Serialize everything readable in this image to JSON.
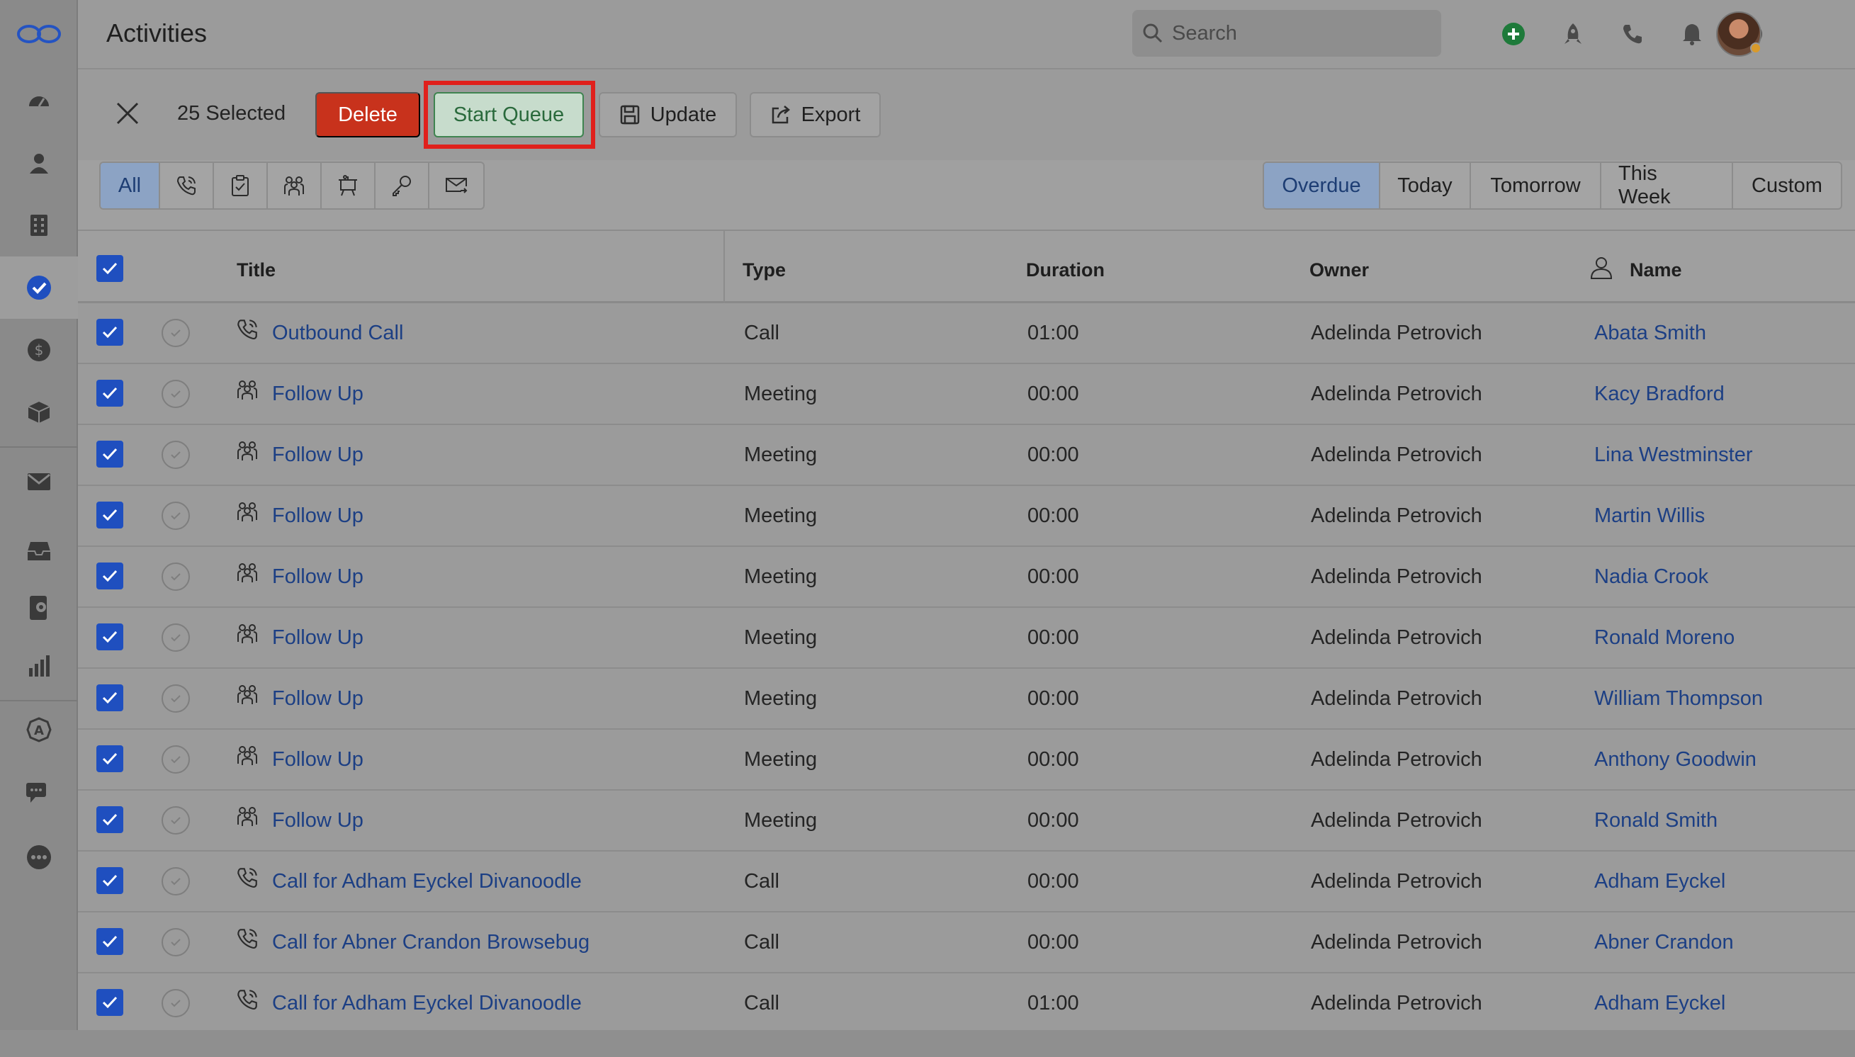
{
  "app": {
    "title": "Activities",
    "search_placeholder": "Search"
  },
  "sidebar": {
    "items": [
      {
        "icon": "dashboard-icon"
      },
      {
        "icon": "person-icon"
      },
      {
        "icon": "building-icon"
      },
      {
        "icon": "activities-check-icon",
        "active": true
      },
      {
        "icon": "dollar-icon"
      },
      {
        "icon": "box-icon"
      },
      {
        "icon": "mail-icon"
      },
      {
        "icon": "inbox-icon"
      },
      {
        "icon": "phone-book-icon"
      },
      {
        "icon": "reports-icon"
      },
      {
        "icon": "automation-icon"
      },
      {
        "icon": "chat-icon"
      },
      {
        "icon": "more-icon"
      }
    ]
  },
  "header_icons": [
    "add-icon",
    "rocket-icon",
    "phone-icon",
    "bell-icon",
    "help-icon"
  ],
  "actions": {
    "selected_label": "25 Selected",
    "delete_label": "Delete",
    "start_queue_label": "Start Queue",
    "update_label": "Update",
    "export_label": "Export"
  },
  "type_filter": {
    "all_label": "All",
    "icons": [
      "phone-icon",
      "task-clipboard-icon",
      "meeting-people-icon",
      "presentation-icon",
      "key-icon",
      "email-icon"
    ]
  },
  "date_filter": [
    "Overdue",
    "Today",
    "Tomorrow",
    "This Week",
    "Custom"
  ],
  "table": {
    "columns": {
      "title": "Title",
      "type": "Type",
      "duration": "Duration",
      "owner": "Owner",
      "name": "Name"
    },
    "rows": [
      {
        "title": "Outbound Call",
        "type": "Call",
        "duration": "01:00",
        "owner": "Adelinda Petrovich",
        "name": "Abata Smith",
        "icon": "phone-icon"
      },
      {
        "title": "Follow Up",
        "type": "Meeting",
        "duration": "00:00",
        "owner": "Adelinda Petrovich",
        "name": "Kacy Bradford",
        "icon": "meeting-people-icon"
      },
      {
        "title": "Follow Up",
        "type": "Meeting",
        "duration": "00:00",
        "owner": "Adelinda Petrovich",
        "name": "Lina Westminster",
        "icon": "meeting-people-icon"
      },
      {
        "title": "Follow Up",
        "type": "Meeting",
        "duration": "00:00",
        "owner": "Adelinda Petrovich",
        "name": "Martin Willis",
        "icon": "meeting-people-icon"
      },
      {
        "title": "Follow Up",
        "type": "Meeting",
        "duration": "00:00",
        "owner": "Adelinda Petrovich",
        "name": "Nadia Crook",
        "icon": "meeting-people-icon"
      },
      {
        "title": "Follow Up",
        "type": "Meeting",
        "duration": "00:00",
        "owner": "Adelinda Petrovich",
        "name": "Ronald Moreno",
        "icon": "meeting-people-icon"
      },
      {
        "title": "Follow Up",
        "type": "Meeting",
        "duration": "00:00",
        "owner": "Adelinda Petrovich",
        "name": "William Thompson",
        "icon": "meeting-people-icon"
      },
      {
        "title": "Follow Up",
        "type": "Meeting",
        "duration": "00:00",
        "owner": "Adelinda Petrovich",
        "name": "Anthony Goodwin",
        "icon": "meeting-people-icon"
      },
      {
        "title": "Follow Up",
        "type": "Meeting",
        "duration": "00:00",
        "owner": "Adelinda Petrovich",
        "name": "Ronald Smith",
        "icon": "meeting-people-icon"
      },
      {
        "title": "Call for Adham Eyckel Divanoodle",
        "type": "Call",
        "duration": "00:00",
        "owner": "Adelinda Petrovich",
        "name": "Adham Eyckel",
        "icon": "phone-icon"
      },
      {
        "title": "Call for Abner Crandon Browsebug",
        "type": "Call",
        "duration": "00:00",
        "owner": "Adelinda Petrovich",
        "name": "Abner Crandon",
        "icon": "phone-icon"
      },
      {
        "title": "Call for Adham Eyckel Divanoodle",
        "type": "Call",
        "duration": "01:00",
        "owner": "Adelinda Petrovich",
        "name": "Adham Eyckel",
        "icon": "phone-icon"
      }
    ]
  },
  "colors": {
    "accent_blue": "#1f4fbf",
    "link": "#1c3f84",
    "delete_red": "#c8321c",
    "start_queue_green": "#2a6a3c",
    "highlight_red": "#e0201c"
  }
}
